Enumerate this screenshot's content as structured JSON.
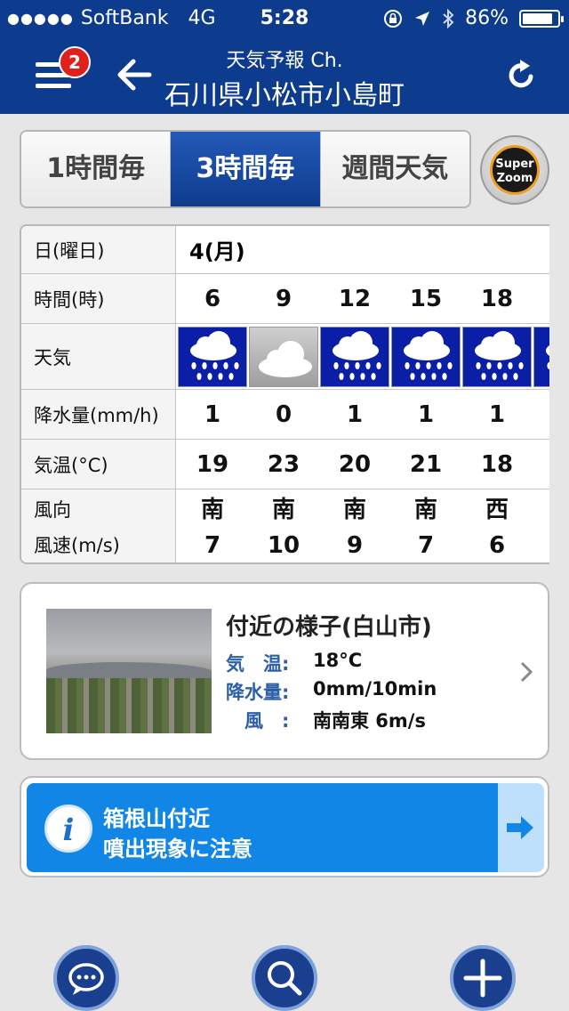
{
  "status_bar": {
    "carrier": "SoftBank",
    "network": "4G",
    "time": "5:28",
    "battery": "86%",
    "battery_level": 0.86
  },
  "header": {
    "badge_count": "2",
    "subtitle": "天気予報 Ch.",
    "title": "石川県小松市小島町"
  },
  "tabs": [
    {
      "label": "1時間毎",
      "active": false
    },
    {
      "label": "3時間毎",
      "active": true
    },
    {
      "label": "週間天気",
      "active": false
    }
  ],
  "super_zoom": {
    "line1": "Super",
    "line2": "Zoom"
  },
  "forecast": {
    "labels": {
      "date": "日(曜日)",
      "hour": "時間(時)",
      "weather": "天気",
      "precip": "降水量(mm/h)",
      "temp": "気温(°C)",
      "wind_dir": "風向",
      "wind_speed": "風速(m/s)"
    },
    "date": "4(月)",
    "hours": [
      "6",
      "9",
      "12",
      "15",
      "18"
    ],
    "weather": [
      "rain-icon",
      "cloud-icon",
      "rain-icon",
      "rain-icon",
      "rain-icon"
    ],
    "precip": [
      "1",
      "0",
      "1",
      "1",
      "1"
    ],
    "temp": [
      "19",
      "23",
      "20",
      "21",
      "18"
    ],
    "wind_dir": [
      "南",
      "南",
      "南",
      "南",
      "西"
    ],
    "wind_speed": [
      "7",
      "10",
      "9",
      "7",
      "6"
    ]
  },
  "nearby": {
    "title": "付近の様子(白山市)",
    "rows": [
      {
        "key": "気　温:",
        "value": "18°C"
      },
      {
        "key": "降水量:",
        "value": "0mm/10min"
      },
      {
        "key": "　風　:",
        "value": "南南東 6m/s"
      }
    ]
  },
  "alert": {
    "line1": "箱根山付近",
    "line2": "噴出現象に注意"
  },
  "bottom_buttons": [
    "chat-icon",
    "search-icon",
    "add-icon"
  ],
  "colors": {
    "header_blue": "#0d3c8f",
    "rain_blue": "#0a1fa6",
    "alert_blue": "#1186e6",
    "badge_red": "#e0201c"
  }
}
